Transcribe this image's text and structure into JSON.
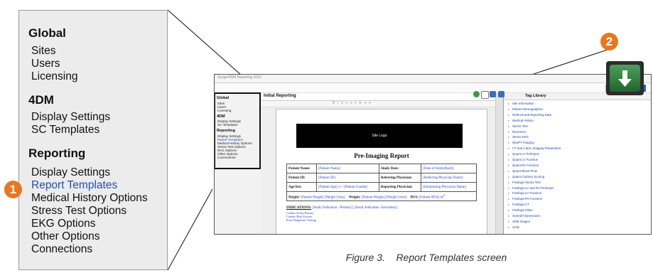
{
  "zoom_panel": {
    "sections": [
      {
        "heading": "Global",
        "items": [
          "Sites",
          "Users",
          "Licensing"
        ]
      },
      {
        "heading": "4DM",
        "items": [
          "Display Settings",
          "SC Templates"
        ]
      },
      {
        "heading": "Reporting",
        "items": [
          "Display Settings",
          "Report Templates",
          "Medical History Options",
          "Stress Test Options",
          "EKG Options",
          "Other Options",
          "Connections"
        ]
      }
    ],
    "selected_item": "Report Templates",
    "badge": "1"
  },
  "app": {
    "window_title": "Syngo/4DM Reporting 2010",
    "sidebar": {
      "global_heading": "Global",
      "global_items": [
        "Sites",
        "Users",
        "Licensing"
      ],
      "fourdm_heading": "4DM",
      "fourdm_items": [
        "Display Settings",
        "SC Templates"
      ],
      "reporting_heading": "Reporting",
      "reporting_items": [
        "Display Settings",
        "Report Templates",
        "Medical History Options",
        "Stress Test Options",
        "EKG Options",
        "Other Options",
        "Connections"
      ]
    },
    "editor": {
      "header": "Initial Reporting",
      "format_bar": "B I U  ≡ ≡ ≡  A  ⇥  ⇤",
      "site_logo": "Site Logo",
      "report_title": "Pre-Imaging Report",
      "table": [
        [
          "Patient Name:",
          "[Patient Name]",
          "Study Date:",
          "[Date of Study(Rest)]"
        ],
        [
          "Patient ID:",
          "[Patient ID]",
          "Referring Physician:",
          "[Referring Physician Name]"
        ],
        [
          "Age/Sex:",
          "[Patient Age] y• / [Patient Gender]",
          "Reporting Physician:",
          "[Interpreting Physician Name]"
        ]
      ],
      "height_row": {
        "height_label": "Height:",
        "height_value": "[Patient Height] [Height Units]",
        "weight_label": "Weight:",
        "weight_value": "[Patient Weight] [Weight Units]",
        "bsa_label": "BSA:",
        "bsa_value": "[Patient BSA] m",
        "bsa_exp": "2"
      },
      "indications_label": "INDICATIONS:",
      "indications_value": "[Study Indication - Primary]; [Study Indication -Secondary]",
      "indications_sub": [
        "Cardiac Event History",
        "Cardiac Risk Factors",
        "Prior Diagnostic Testing"
      ]
    },
    "right_pane": {
      "heading": "Tag Library",
      "items": [
        "Site Information",
        "Patient Demographics",
        "Referral and Reporting Data",
        "Medical History",
        "Stress Test",
        "Rest EKG",
        "Stress EKG",
        "MyoPT Imaging",
        "CT and Calcic Imaging Parameters",
        "Quant LV Perfusion",
        "Quant LV Function",
        "Quant RV Function",
        "Quant Blood Flow",
        "Quant Calcium Scoring",
        "Findings-Stress Test",
        "Findings-LV and RV Perfusion",
        "Findings-LV Function",
        "Findings-RV Function",
        "Findings-CT",
        "Findings-Other",
        "Overall Impressions",
        "4DM Images",
        "Units"
      ]
    }
  },
  "callout_2": {
    "badge": "2",
    "icon": "download-arrow-icon"
  },
  "colors": {
    "badge": "#e8771e",
    "selected": "#1f4fbf",
    "download_green": "#2f7a3a"
  },
  "caption": "Figure 3.    Report Templates screen"
}
